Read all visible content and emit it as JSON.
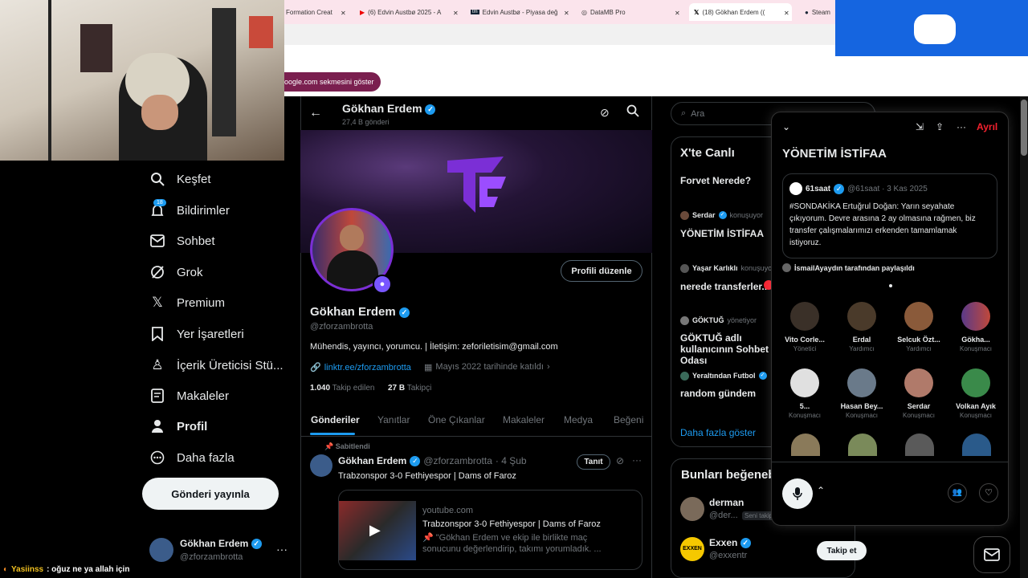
{
  "browser": {
    "tabs": [
      {
        "label": "Formation Creat"
      },
      {
        "label": "(6) Edvin Austbø 2025 - A"
      },
      {
        "label": "Edvin Austbø - Piyasa değ"
      },
      {
        "label": "DataMB Pro"
      },
      {
        "label": "(18) Gökhan Erdem (("
      },
      {
        "label": "Steam"
      }
    ],
    "info_chip": "oogle.com sekmesini göster"
  },
  "nav": {
    "items": [
      {
        "label": "Keşfet",
        "icon": "search-icon"
      },
      {
        "label": "Bildirimler",
        "icon": "bell-icon"
      },
      {
        "label": "Sohbet",
        "icon": "mail-icon"
      },
      {
        "label": "Grok",
        "icon": "grok-icon"
      },
      {
        "label": "Premium",
        "icon": "x-logo-icon"
      },
      {
        "label": "Yer İşaretleri",
        "icon": "bookmark-icon"
      },
      {
        "label": "İçerik Üreticisi Stü...",
        "icon": "creator-studio-icon"
      },
      {
        "label": "Makaleler",
        "icon": "article-icon"
      },
      {
        "label": "Profil",
        "icon": "person-icon"
      },
      {
        "label": "Daha fazla",
        "icon": "more-circle-icon"
      }
    ],
    "notif_badge": "18",
    "post_button": "Gönderi yayınla",
    "account_name": "Gökhan Erdem",
    "account_handle": "@zforzambrotta",
    "more": "···"
  },
  "chat_overlay": {
    "user": "Yasiinss",
    "text": ": oğuz ne ya allah için"
  },
  "profile": {
    "header_name": "Gökhan Erdem",
    "header_posts": "27,4 B gönderi",
    "edit_button": "Profili düzenle",
    "name": "Gökhan Erdem",
    "handle": "@zforzambrotta",
    "bio": "Mühendis, yayıncı, yorumcu. | İletişim: zeforiletisim@gmail.com",
    "link": "linktr.ee/zforzambrotta",
    "joined": "Mayıs 2022 tarihinde katıldı",
    "following_count": "1.040",
    "following_label": "Takip edilen",
    "followers_count": "27 B",
    "followers_label": "Takipçi",
    "tabs": [
      "Gönderiler",
      "Yanıtlar",
      "Öne Çıkanlar",
      "Makaleler",
      "Medya",
      "Beğeni"
    ]
  },
  "pinned_post": {
    "pinned_label": "Sabitlendi",
    "author": "Gökhan Erdem",
    "handle": "@zforzambrotta",
    "date": "· 4 Şub",
    "tanit": "Tanıt",
    "text": "Trabzonspor 3-0 Fethiyespor | Dams of Faroz",
    "card_domain": "youtube.com",
    "card_title": "Trabzonspor 3-0 Fethiyespor | Dams of Faroz",
    "card_desc": "📌 \"Gökhan Erdem ve ekip ile birlikte maç sonucunu değerlendirip, takımı yorumladık. ..."
  },
  "right": {
    "search_placeholder": "Ara",
    "live_title": "X'te Canlı",
    "live_items": [
      {
        "host": "",
        "role": "",
        "title": "Forvet Nerede?"
      },
      {
        "host": "Serdar",
        "role": "konuşuyor",
        "title": "YÖNETİM İSTİFAA"
      },
      {
        "host": "Yaşar Karlıklı",
        "role": "konuşuyor",
        "title": "nerede transferler.."
      },
      {
        "host": "GÖKTUĞ",
        "role": "yönetiyor",
        "title": "GÖKTUĞ adlı kullanıcının Sohbet Odası"
      },
      {
        "host": "Yeraltından Futbol",
        "role": "",
        "title": "random gündem"
      }
    ],
    "show_more": "Daha fazla göster",
    "suggest_title": "Bunları beğeneb",
    "suggestions": [
      {
        "name": "derman",
        "handle": "@der...",
        "tag": "Seni takip"
      },
      {
        "name": "Exxen",
        "handle": "@exxentr",
        "button": "Takip et"
      }
    ]
  },
  "space": {
    "leave": "Ayrıl",
    "title": "YÖNETİM İSTİFAA",
    "quote_author": "61saat",
    "quote_meta": "@61saat · 3 Kas 2025",
    "quote_text": "#SONDAKİKA Ertuğrul Doğan: Yarın seyahate çıkıyorum. Devre arasına 2 ay olmasına rağmen, biz transfer çalışmalarımızı erkenden tamamlamak istiyoruz.",
    "shared_by": "İsmailAyaydın tarafından paylaşıldı",
    "speakers": [
      {
        "name": "Vito Corle...",
        "role": "Yönetici"
      },
      {
        "name": "Erdal",
        "role": "Yardımcı"
      },
      {
        "name": "Selcuk Özt...",
        "role": "Yardımcı"
      },
      {
        "name": "Gökha...",
        "role": "Konuşmacı"
      },
      {
        "name": "5...",
        "role": "Konuşmacı"
      },
      {
        "name": "Hasan Bey...",
        "role": "Konuşmacı"
      },
      {
        "name": "Serdar",
        "role": "Konuşmacı"
      },
      {
        "name": "Volkan Ayık",
        "role": "Konuşmacı"
      }
    ]
  },
  "colors": {
    "accent": "#1d9bf0",
    "leave": "#f4212e",
    "chrome_tab": "#fbe4ec",
    "blue_block": "#1565e0"
  }
}
